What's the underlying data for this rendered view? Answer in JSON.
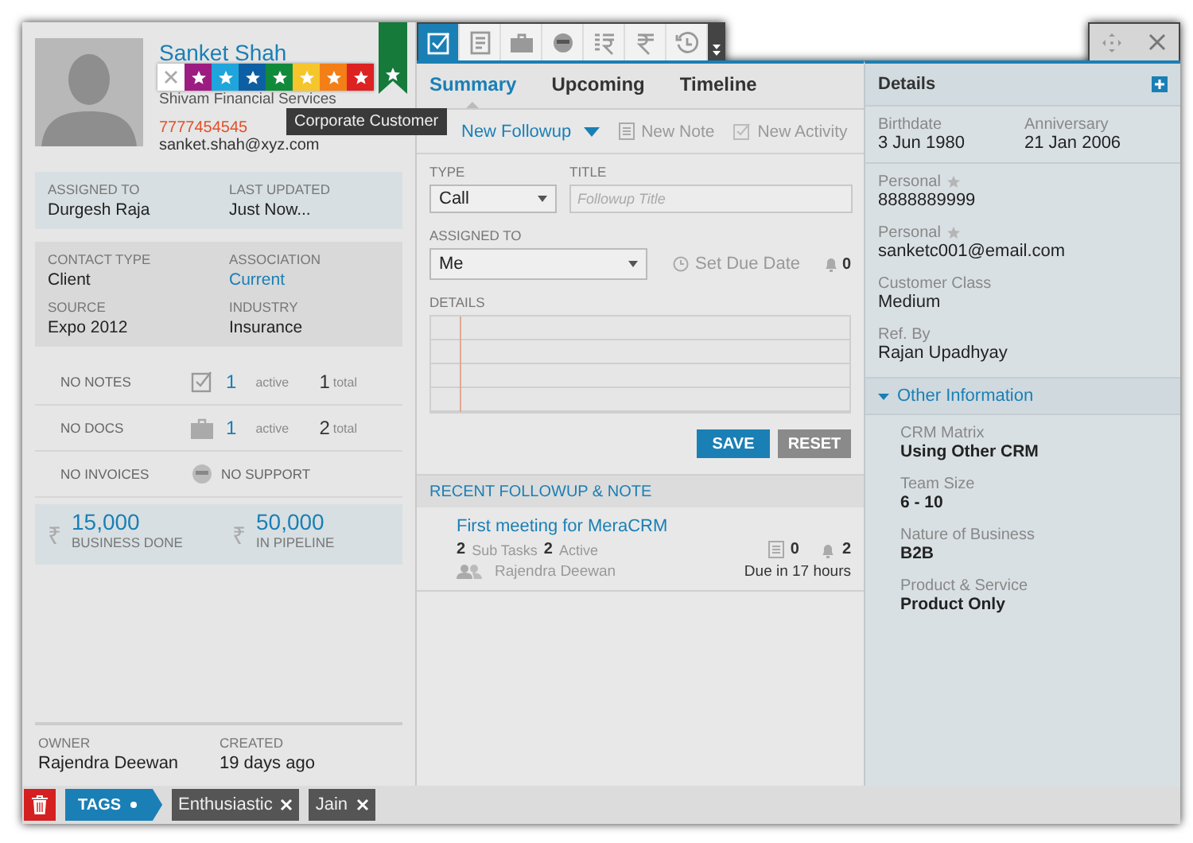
{
  "contact": {
    "name": "Sanket Shah",
    "company": "Shivam Financial Services",
    "phone": "7777454545",
    "email": "sanket.shah@xyz.com",
    "tooltip": "Corporate Customer"
  },
  "color_swatches": [
    {
      "color": "#9c1c82"
    },
    {
      "color": "#1fa5dc"
    },
    {
      "color": "#0d5fa3"
    },
    {
      "color": "#128a3c"
    },
    {
      "color": "#f5c52b"
    },
    {
      "color": "#f47f17"
    },
    {
      "color": "#dd2222"
    }
  ],
  "assignment": [
    {
      "label": "ASSIGNED TO",
      "value": "Durgesh Raja"
    },
    {
      "label": "LAST UPDATED",
      "value": "Just Now..."
    }
  ],
  "contact_info": [
    {
      "label": "CONTACT TYPE",
      "value": "Client",
      "link": false
    },
    {
      "label": "ASSOCIATION",
      "value": "Current",
      "link": true
    },
    {
      "label": "SOURCE",
      "value": "Expo 2012",
      "link": false
    },
    {
      "label": "INDUSTRY",
      "value": "Insurance",
      "link": false
    }
  ],
  "stats": [
    {
      "kind": "counts",
      "label": "NO NOTES",
      "active": "1",
      "active_label": "active",
      "total": "1",
      "total_label": "total"
    },
    {
      "kind": "counts",
      "label": "NO DOCS",
      "active": "1",
      "active_label": "active",
      "total": "2",
      "total_label": "total"
    },
    {
      "kind": "text",
      "label": "NO INVOICES",
      "text": "NO SUPPORT"
    }
  ],
  "money": [
    {
      "currency": "₹",
      "amount": "15,000",
      "label": "BUSINESS DONE"
    },
    {
      "currency": "₹",
      "amount": "50,000",
      "label": "IN PIPELINE"
    }
  ],
  "footer": [
    {
      "label": "OWNER",
      "value": "Rajendra Deewan"
    },
    {
      "label": "CREATED",
      "value": "19 days ago"
    }
  ],
  "tags_bar": {
    "label": "TAGS",
    "tags": [
      "Enthusiastic",
      "Jain"
    ]
  },
  "toolbar": [
    {
      "selected": true
    },
    {
      "selected": false
    },
    {
      "selected": false
    },
    {
      "selected": false
    },
    {
      "selected": false
    },
    {
      "selected": false
    },
    {
      "selected": false
    }
  ],
  "tabs": [
    {
      "label": "Summary",
      "selected": true
    },
    {
      "label": "Upcoming",
      "selected": false
    },
    {
      "label": "Timeline",
      "selected": false
    }
  ],
  "actions": [
    {
      "label": "New Followup",
      "selected": true
    },
    {
      "label": "New Note",
      "selected": false
    },
    {
      "label": "New Activity",
      "selected": false
    }
  ],
  "form": {
    "type_label": "TYPE",
    "type_value": "Call",
    "title_label": "TITLE",
    "title_placeholder": "Followup Title",
    "assigned_label": "ASSIGNED TO",
    "assigned_value": "Me",
    "due_date": "Set Due Date",
    "reminders": "0",
    "details_label": "DETAILS",
    "buttons": [
      {
        "label": "SAVE",
        "kind": "primary"
      },
      {
        "label": "RESET",
        "kind": "secondary"
      }
    ]
  },
  "recent": {
    "title": "RECENT FOLLOWUP & NOTE",
    "items": [
      {
        "title": "First meeting for MeraCRM",
        "subtasks": "2",
        "subtasks_label": "Sub Tasks",
        "active": "2",
        "active_label": "Active",
        "notes": "0",
        "reminders": "2",
        "owner": "Rajendra Deewan",
        "due": "Due in 17 hours"
      }
    ]
  },
  "details": {
    "title": "Details",
    "dates": [
      {
        "label": "Birthdate",
        "value": "3 Jun 1980"
      },
      {
        "label": "Anniversary",
        "value": "21 Jan 2006"
      }
    ],
    "fields": [
      {
        "label": "Personal",
        "primary": false,
        "value": "8888889999"
      },
      {
        "label": "Personal",
        "primary": false,
        "value": "sanketc001@email.com"
      },
      {
        "label": "Customer Class",
        "value": "Medium"
      },
      {
        "label": "Ref. By",
        "value": "Rajan Upadhyay"
      }
    ],
    "other": {
      "title": "Other Information",
      "expanded": true,
      "fields": [
        {
          "label": "CRM Matrix",
          "value": "Using Other CRM"
        },
        {
          "label": "Team Size",
          "value": "6 - 10"
        },
        {
          "label": "Nature of Business",
          "value": "B2B"
        },
        {
          "label": "Product & Service",
          "value": "Product Only"
        }
      ]
    }
  }
}
